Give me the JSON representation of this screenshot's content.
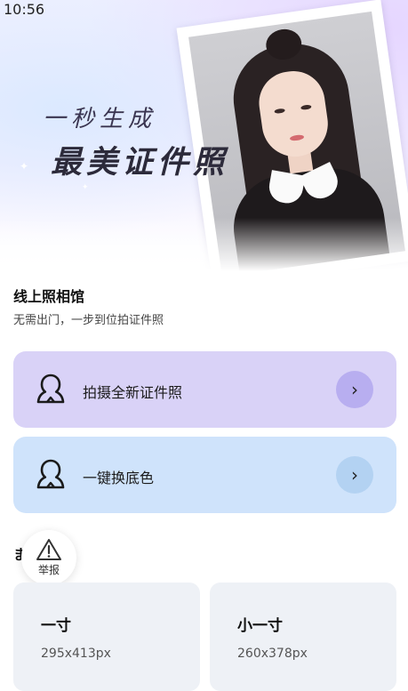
{
  "status_bar": {
    "time": "10:56"
  },
  "hero": {
    "slogan_line1": "一秒生成",
    "slogan_line2": "最美证件照"
  },
  "section": {
    "title": "线上照相馆",
    "subtitle": "无需出门，一步到位拍证件照"
  },
  "actions": [
    {
      "label": "拍摄全新证件照",
      "icon": "person-outline-icon",
      "color": "#d9d2f7"
    },
    {
      "label": "一键换底色",
      "icon": "person-outline-icon",
      "color": "#cfe3fb"
    }
  ],
  "partial_heading": "ま",
  "report": {
    "label": "举报",
    "icon": "warning-triangle-icon"
  },
  "sizes": [
    {
      "name": "一寸",
      "dimensions": "295x413px"
    },
    {
      "name": "小一寸",
      "dimensions": "260x378px"
    }
  ]
}
